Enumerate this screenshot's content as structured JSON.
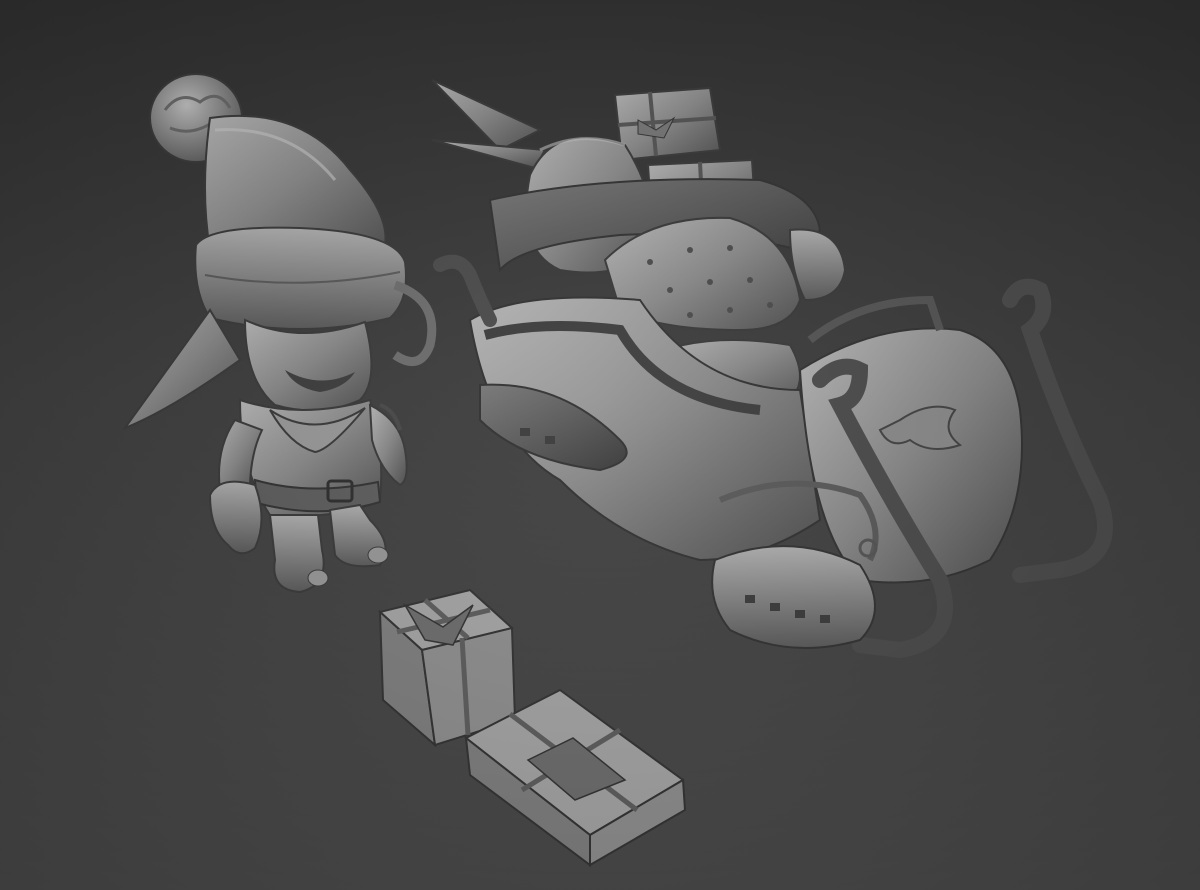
{
  "scene": {
    "description_icons": [
      "elf-sculpt",
      "sleigh-sculpt",
      "gift-box-sculpt"
    ],
    "colors": {
      "background_top": "#303030",
      "background_bottom": "#4a4a4a",
      "clay_light": "#a9a9a9",
      "clay_mid": "#7d7d7d",
      "clay_dark": "#4a4a4a"
    }
  }
}
